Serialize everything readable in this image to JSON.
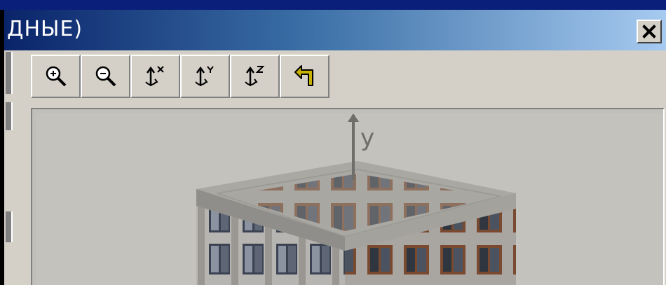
{
  "window": {
    "title": "ДНЫЕ)",
    "close_label": "X"
  },
  "toolbar": {
    "buttons": [
      {
        "name": "zoom-in",
        "icon": "zoom-in-icon"
      },
      {
        "name": "zoom-out",
        "icon": "zoom-out-icon"
      },
      {
        "name": "rotate-x",
        "icon": "rotate-x-icon",
        "axis": "x"
      },
      {
        "name": "rotate-y",
        "icon": "rotate-y-icon",
        "axis": "y"
      },
      {
        "name": "rotate-z",
        "icon": "rotate-z-icon",
        "axis": "z"
      },
      {
        "name": "undo",
        "icon": "undo-arrow-icon"
      }
    ]
  },
  "viewport": {
    "axis_label": "y",
    "object": "3d-building-model"
  },
  "colors": {
    "titlebar_start": "#0a246a",
    "titlebar_end": "#a6caf0",
    "face": "#d4d0c8"
  }
}
